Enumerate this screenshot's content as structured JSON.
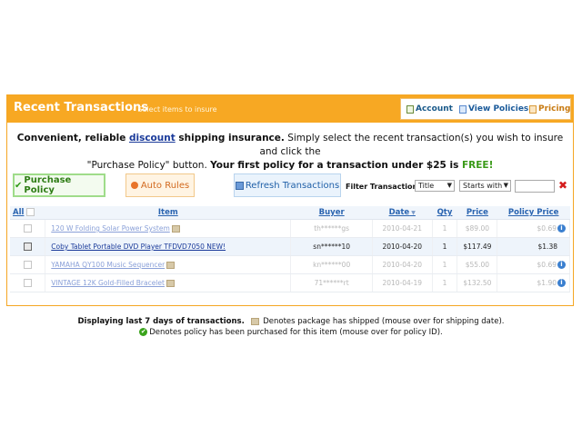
{
  "header": {
    "title": "Recent Transactions",
    "subtitle": "- Select items to insure",
    "links": [
      {
        "label": "Account",
        "icon": "document-icon"
      },
      {
        "label": "View Policies",
        "icon": "policies-icon"
      },
      {
        "label": "Pricing",
        "icon": "pricing-icon"
      }
    ]
  },
  "intro": {
    "line1_a": "Convenient, reliable ",
    "line1_link": "discount",
    "line1_b": " shipping insurance.",
    "line1_c": " Simply select the recent transaction(s) you wish to insure and click the",
    "line2_a": "\"Purchase Policy\" button. ",
    "line2_b": "Your first policy for a transaction under $25 is ",
    "line2_free": "FREE!"
  },
  "toolbar": {
    "purchase_label": "Purchase Policy",
    "rules_label": "Auto Rules",
    "refresh_label": "Refresh Transactions",
    "filter_label": "Filter Transactions:",
    "filter_field": "Title",
    "filter_mode": "Starts with"
  },
  "table": {
    "all_label": "All",
    "columns": {
      "item": "Item",
      "buyer": "Buyer",
      "date": "Date",
      "qty": "Qty",
      "price": "Price",
      "policy_price": "Policy Price"
    },
    "rows": [
      {
        "item": "120 W Folding Solar Power System",
        "buyer": "th******gs",
        "date": "2010-04-21",
        "qty": "1",
        "price": "$89.00",
        "policy": "$0.69"
      },
      {
        "item": "Coby Tablet Portable DVD Player TFDVD7050 NEW!",
        "buyer": "sn******10",
        "date": "2010-04-20",
        "qty": "1",
        "price": "$117.49",
        "policy": "$1.38"
      },
      {
        "item": "YAMAHA QY100 Music Sequencer",
        "buyer": "kn******00",
        "date": "2010-04-20",
        "qty": "1",
        "price": "$55.00",
        "policy": "$0.69"
      },
      {
        "item": "VINTAGE 12K Gold-Filled Bracelet",
        "buyer": "71******rt",
        "date": "2010-04-19",
        "qty": "1",
        "price": "$132.50",
        "policy": "$1.90"
      }
    ]
  },
  "footer": {
    "days_text": "Displaying last 7 days of transactions.",
    "shipped_text": "Denotes package has shipped (mouse over for shipping date).",
    "purchased_text": "Denotes policy has been purchased for this item (mouse over for policy ID)."
  },
  "colors": {
    "accent": "#f7a823",
    "link": "#2a64b0",
    "green": "#3a9a18"
  }
}
